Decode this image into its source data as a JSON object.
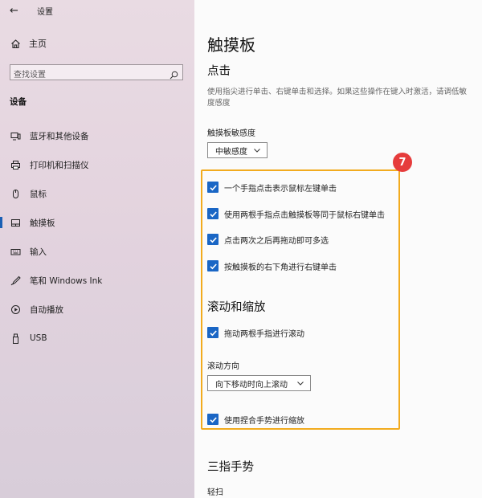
{
  "window": {
    "back_symbol": "←",
    "app_title": "设置"
  },
  "sidebar": {
    "home_label": "主页",
    "search": {
      "placeholder": "查找设置"
    },
    "section_label": "设备",
    "items": [
      {
        "label": "蓝牙和其他设备",
        "icon": "bluetooth-devices-icon"
      },
      {
        "label": "打印机和扫描仪",
        "icon": "printer-icon"
      },
      {
        "label": "鼠标",
        "icon": "mouse-icon"
      },
      {
        "label": "触摸板",
        "icon": "touchpad-icon",
        "active": true
      },
      {
        "label": "输入",
        "icon": "keyboard-icon"
      },
      {
        "label": "笔和 Windows Ink",
        "icon": "pen-icon"
      },
      {
        "label": "自动播放",
        "icon": "autoplay-icon"
      },
      {
        "label": "USB",
        "icon": "usb-icon"
      }
    ]
  },
  "main": {
    "title": "触摸板",
    "tap": {
      "heading": "点击",
      "description": "使用指尖进行单击、右键单击和选择。如果这些操作在键入时激活，请调低敏度感度",
      "sensitivity_label": "触摸板敏感度",
      "sensitivity_value": "中敏感度",
      "options": [
        {
          "label": "一个手指点击表示鼠标左键单击",
          "checked": true
        },
        {
          "label": "使用两根手指点击触摸板等同于鼠标右键单击",
          "checked": true
        },
        {
          "label": "点击两次之后再拖动即可多选",
          "checked": true
        },
        {
          "label": "按触摸板的右下角进行右键单击",
          "checked": true
        }
      ]
    },
    "scroll": {
      "heading": "滚动和缩放",
      "drag_scroll": {
        "label": "拖动两根手指进行滚动",
        "checked": true
      },
      "direction_label": "滚动方向",
      "direction_value": "向下移动时向上滚动",
      "pinch_zoom": {
        "label": "使用捏合手势进行缩放",
        "checked": true
      }
    },
    "three_finger": {
      "heading": "三指手势",
      "swipe_label": "轻扫"
    },
    "annotation": {
      "badge": "7",
      "color": "#f2ab1e",
      "badge_color": "#e63c3c"
    }
  },
  "colors": {
    "accent": "#1a66c5",
    "sidebar_bg": "#e3d3de"
  }
}
